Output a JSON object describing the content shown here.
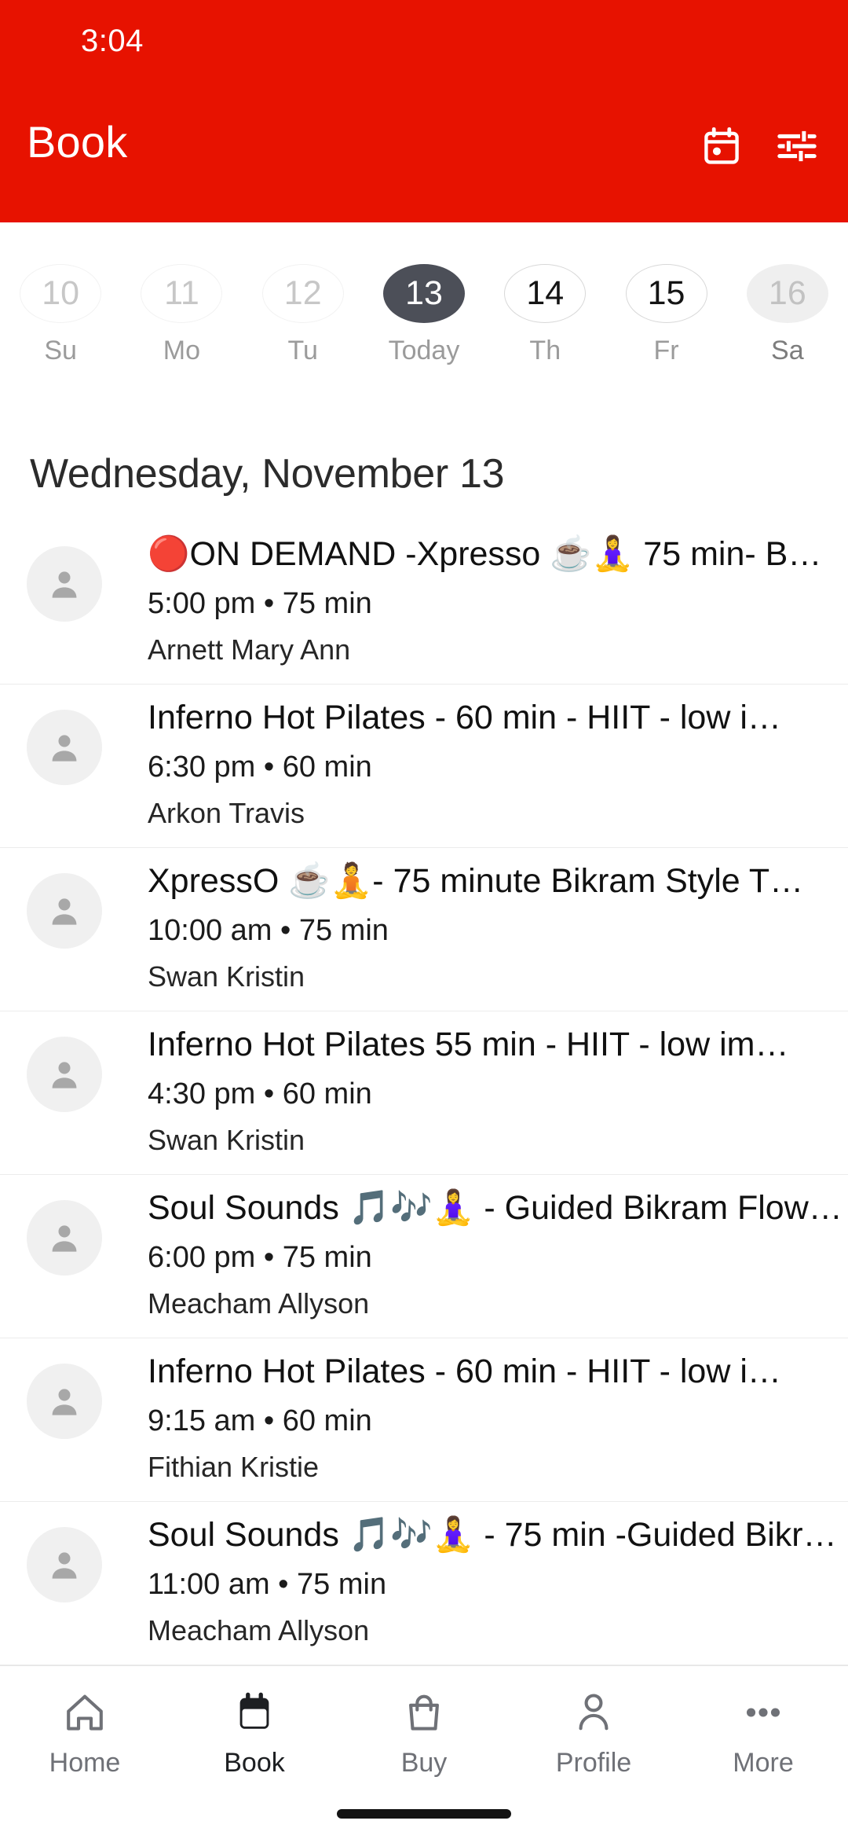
{
  "theme": {
    "brand_red": "#E71200",
    "today_fill": "#4C4F58",
    "text_dark": "#111111",
    "muted": "#9b9b9b"
  },
  "status_bar": {
    "time": "3:04"
  },
  "header": {
    "title": "Book",
    "calendar_icon": "calendar-icon",
    "filter_icon": "filter-sliders-icon"
  },
  "date_strip": {
    "days": [
      {
        "date": "10",
        "label": "Su",
        "state": "past"
      },
      {
        "date": "11",
        "label": "Mo",
        "state": "past"
      },
      {
        "date": "12",
        "label": "Tu",
        "state": "past"
      },
      {
        "date": "13",
        "label": "Today",
        "state": "today"
      },
      {
        "date": "14",
        "label": "Th",
        "state": "avail"
      },
      {
        "date": "15",
        "label": "Fr",
        "state": "avail"
      },
      {
        "date": "16",
        "label": "Sa",
        "state": "future"
      }
    ]
  },
  "day_heading": "Wednesday, November 13",
  "classes": [
    {
      "title": "🔴ON DEMAND -Xpresso ☕🧘‍♀️ 75 min- B…",
      "meta": "5:00 pm • 75 min",
      "instructor": "Arnett Mary Ann",
      "avatar_icon": "person-avatar-icon"
    },
    {
      "title": "Inferno Hot Pilates - 60 min - HIIT - low i…",
      "meta": "6:30 pm • 60 min",
      "instructor": "Arkon Travis",
      "avatar_icon": "person-avatar-icon"
    },
    {
      "title": "XpressO ☕🧘‍- 75 minute Bikram Style T…",
      "meta": "10:00 am • 75 min",
      "instructor": "Swan Kristin",
      "avatar_icon": "person-avatar-icon"
    },
    {
      "title": "Inferno Hot Pilates 55 min - HIIT - low im…",
      "meta": "4:30 pm • 60 min",
      "instructor": "Swan Kristin",
      "avatar_icon": "person-avatar-icon"
    },
    {
      "title": "Soul Sounds 🎵🎶🧘‍♀️ - Guided Bikram Flow…",
      "meta": "6:00 pm • 75 min",
      "instructor": "Meacham Allyson",
      "avatar_icon": "person-avatar-icon"
    },
    {
      "title": "Inferno Hot Pilates - 60 min - HIIT - low i…",
      "meta": "9:15 am • 60 min",
      "instructor": "Fithian Kristie",
      "avatar_icon": "person-avatar-icon"
    },
    {
      "title": "Soul Sounds 🎵🎶🧘‍♀️ - 75 min -Guided Bikr…",
      "meta": "11:00 am • 75 min",
      "instructor": "Meacham Allyson",
      "avatar_icon": "person-avatar-icon"
    }
  ],
  "bottom_nav": {
    "items": [
      {
        "label": "Home",
        "icon": "home-icon",
        "active": false
      },
      {
        "label": "Book",
        "icon": "calendar-icon",
        "active": true
      },
      {
        "label": "Buy",
        "icon": "bag-icon",
        "active": false
      },
      {
        "label": "Profile",
        "icon": "person-icon",
        "active": false
      },
      {
        "label": "More",
        "icon": "ellipsis-icon",
        "active": false
      }
    ]
  }
}
